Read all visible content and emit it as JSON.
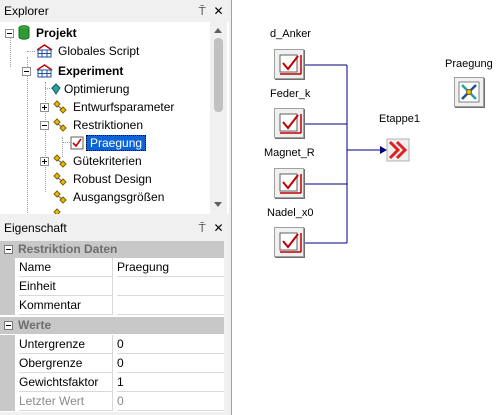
{
  "explorer": {
    "title": "Explorer",
    "pin_glyph": "⍑",
    "close_glyph": "✕",
    "tree": [
      {
        "label": "Projekt",
        "bold": true,
        "icon": "database-icon"
      },
      {
        "label": "Globales Script",
        "bold": false,
        "icon": "script-icon"
      },
      {
        "label": "Experiment",
        "bold": true,
        "icon": "experiment-icon"
      },
      {
        "label": "Optimierung",
        "bold": false,
        "icon": "optimization-icon"
      },
      {
        "label": "Entwurfsparameter",
        "bold": false,
        "icon": "parameter-icon"
      },
      {
        "label": "Restriktionen",
        "bold": false,
        "icon": "parameter-icon"
      },
      {
        "label": "Praegung",
        "bold": false,
        "icon": "restriction-item-icon",
        "selected": true
      },
      {
        "label": "Gütekriterien",
        "bold": false,
        "icon": "parameter-icon"
      },
      {
        "label": "Robust Design",
        "bold": false,
        "icon": "parameter-icon"
      },
      {
        "label": "Ausgangsgrößen",
        "bold": false,
        "icon": "parameter-icon"
      }
    ]
  },
  "properties": {
    "title": "Eigenschaft",
    "pin_glyph": "⍑",
    "close_glyph": "✕",
    "categories": [
      {
        "label": "Restriktion Daten",
        "rows": [
          {
            "name": "Name",
            "value": "Praegung"
          },
          {
            "name": "Einheit",
            "value": ""
          },
          {
            "name": "Kommentar",
            "value": ""
          }
        ]
      },
      {
        "label": "Werte",
        "rows": [
          {
            "name": "Untergrenze",
            "value": "0"
          },
          {
            "name": "Obergrenze",
            "value": "0"
          },
          {
            "name": "Gewichtsfaktor",
            "value": "1"
          },
          {
            "name": "Letzter Wert",
            "value": "0",
            "disabled": true
          }
        ]
      }
    ]
  },
  "canvas": {
    "inputs": [
      {
        "label": "d_Anker"
      },
      {
        "label": "Feder_k"
      },
      {
        "label": "Magnet_R"
      },
      {
        "label": "Nadel_x0"
      }
    ],
    "stage": {
      "label": "Etappe1"
    },
    "tool": {
      "label": "Praegung"
    },
    "colors": {
      "connector": "#000080",
      "check_red": "#c00000"
    }
  }
}
